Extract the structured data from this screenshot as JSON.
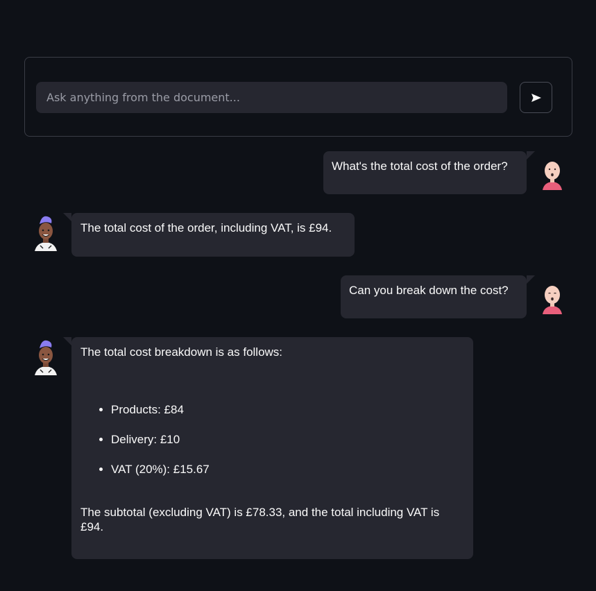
{
  "query_form": {
    "placeholder": "Ask anything from the document...",
    "send_icon": "send-arrow-icon"
  },
  "messages": [
    {
      "role": "user",
      "avatar": "bald-user-avatar",
      "text": "What's the total cost of the order?"
    },
    {
      "role": "bot",
      "avatar": "purple-mohawk-bot-avatar",
      "text": "The total cost of the order, including VAT, is £94."
    },
    {
      "role": "user",
      "avatar": "bald-user-avatar",
      "text": "Can you break down the cost?"
    },
    {
      "role": "bot",
      "avatar": "purple-mohawk-bot-avatar",
      "intro": "The total cost breakdown is as follows:",
      "items": [
        "Products: £84",
        "Delivery: £10",
        "VAT (20%): £15.67"
      ],
      "outro": "The subtotal (excluding VAT) is £78.33, and the total including VAT is £94."
    }
  ],
  "colors": {
    "background": "#0e1117",
    "bubble": "#262730",
    "text": "#fafafa",
    "placeholder": "#9a9ca6",
    "border": "#3a3d46",
    "user_avatar_shirt": "#e95f7b",
    "bot_avatar_hair": "#8a7cf0"
  }
}
